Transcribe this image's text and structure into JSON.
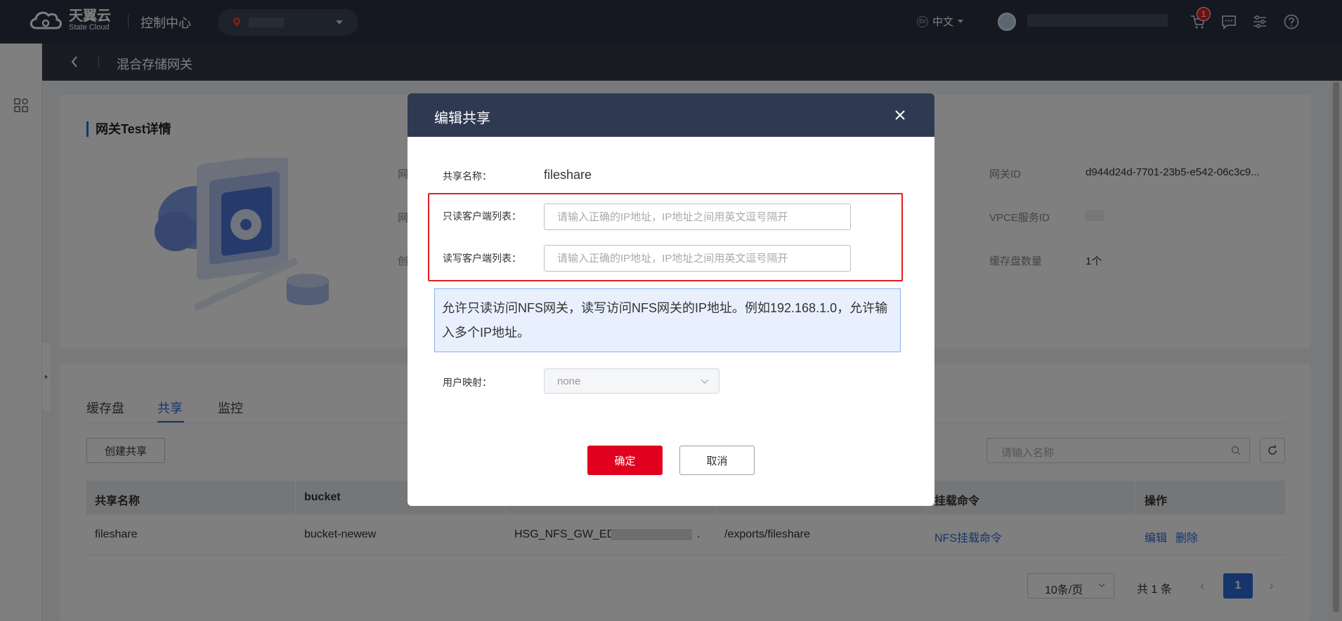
{
  "topbar": {
    "logo_cn": "天翼云",
    "logo_en": "State Cloud",
    "console": "控制中心",
    "language": "中文",
    "cart_badge": "1",
    "icons": [
      "cart-icon",
      "message-icon",
      "settings-icon",
      "help-icon"
    ]
  },
  "subbar": {
    "title": "混合存储网关"
  },
  "detail": {
    "title": "网关Test详情",
    "left_labels": [
      "网",
      "网",
      "创"
    ],
    "right": [
      {
        "label": "网关ID",
        "value": "d944d24d-7701-23b5-e542-06c3c9..."
      },
      {
        "label": "VPCE服务ID",
        "value": ""
      },
      {
        "label": "缓存盘数量",
        "value": "1个"
      }
    ]
  },
  "tabs": [
    {
      "label": "缓存盘",
      "active": false
    },
    {
      "label": "共享",
      "active": true
    },
    {
      "label": "监控",
      "active": false
    }
  ],
  "toolbar": {
    "create_label": "创建共享",
    "search_placeholder": "请输入名称"
  },
  "table": {
    "headers": [
      "共享名称",
      "bucket",
      "",
      "",
      "挂载命令",
      "操作"
    ],
    "rows": [
      {
        "name": "fileshare",
        "bucket": "bucket-newew",
        "gateway": "HSG_NFS_GW_EDS",
        "gateway_suffix": ".",
        "path": "/exports/fileshare",
        "mount": "NFS挂载命令",
        "actions": [
          "编辑",
          "删除"
        ]
      }
    ]
  },
  "pagination": {
    "page_size": "10条/页",
    "total": "共 1 条",
    "current": "1"
  },
  "modal": {
    "title": "编辑共享",
    "share_name_label": "共享名称：",
    "share_name_value": "fileshare",
    "readonly_label": "只读客户端列表：",
    "readonly_placeholder": "请输入正确的IP地址，IP地址之间用英文逗号隔开",
    "readwrite_label": "读写客户端列表：",
    "readwrite_placeholder": "请输入正确的IP地址，IP地址之间用英文逗号隔开",
    "tip": "允许只读访问NFS网关，读写访问NFS网关的IP地址。例如192.168.1.0，允许输入多个IP地址。",
    "user_mapping_label": "用户映射：",
    "user_mapping_value": "none",
    "confirm_label": "确定",
    "cancel_label": "取消"
  },
  "colors": {
    "topbar": "#2a3140",
    "accent_blue": "#2d6ad8",
    "confirm_red": "#e1001e",
    "highlight_red": "#e02020"
  }
}
